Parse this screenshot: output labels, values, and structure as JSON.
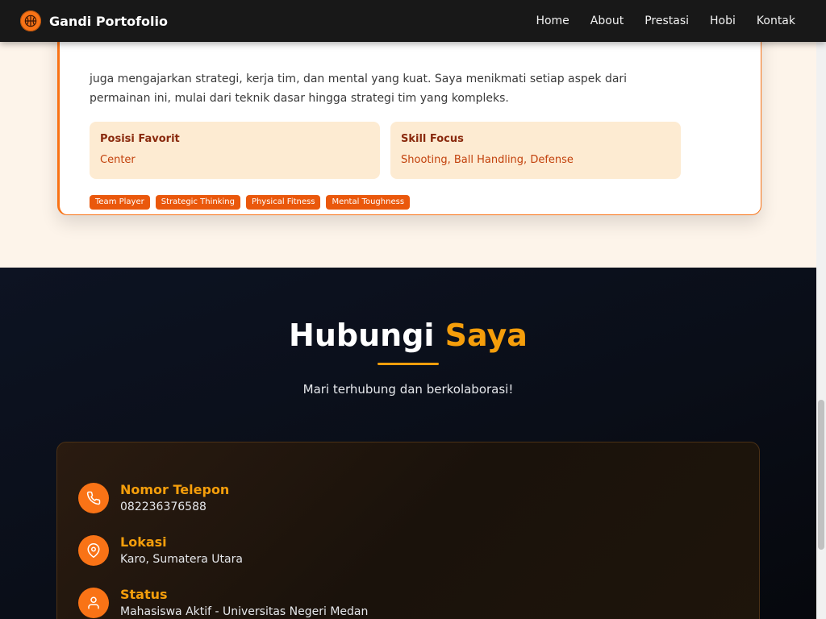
{
  "nav": {
    "brand": "Gandi Portofolio",
    "brand_icon": "basketball-icon",
    "links": [
      "Home",
      "About",
      "Prestasi",
      "Hobi",
      "Kontak"
    ]
  },
  "hobby": {
    "description": "juga mengajarkan strategi, kerja tim, dan mental yang kuat. Saya menikmati setiap aspek dari permainan ini, mulai dari teknik dasar hingga strategi tim yang kompleks.",
    "position": {
      "title": "Posisi Favorit",
      "value": "Center"
    },
    "skill": {
      "title": "Skill Focus",
      "value": "Shooting, Ball Handling, Defense"
    },
    "tags": [
      "Team Player",
      "Strategic Thinking",
      "Physical Fitness",
      "Mental Toughness"
    ]
  },
  "contact": {
    "title_main": "Hubungi",
    "title_accent": "Saya",
    "subtitle": "Mari terhubung dan berkolaborasi!",
    "items": [
      {
        "icon": "phone-icon",
        "label": "Nomor Telepon",
        "value": "082236376588"
      },
      {
        "icon": "map-pin-icon",
        "label": "Lokasi",
        "value": "Karo, Sumatera Utara"
      },
      {
        "icon": "user-icon",
        "label": "Status",
        "value": "Mahasiswa Aktif - Universitas Negeri Medan"
      }
    ]
  },
  "colors": {
    "accent": "#f97316",
    "accent_gold": "#f59e0b",
    "dark_bg": "#0a0e18"
  }
}
